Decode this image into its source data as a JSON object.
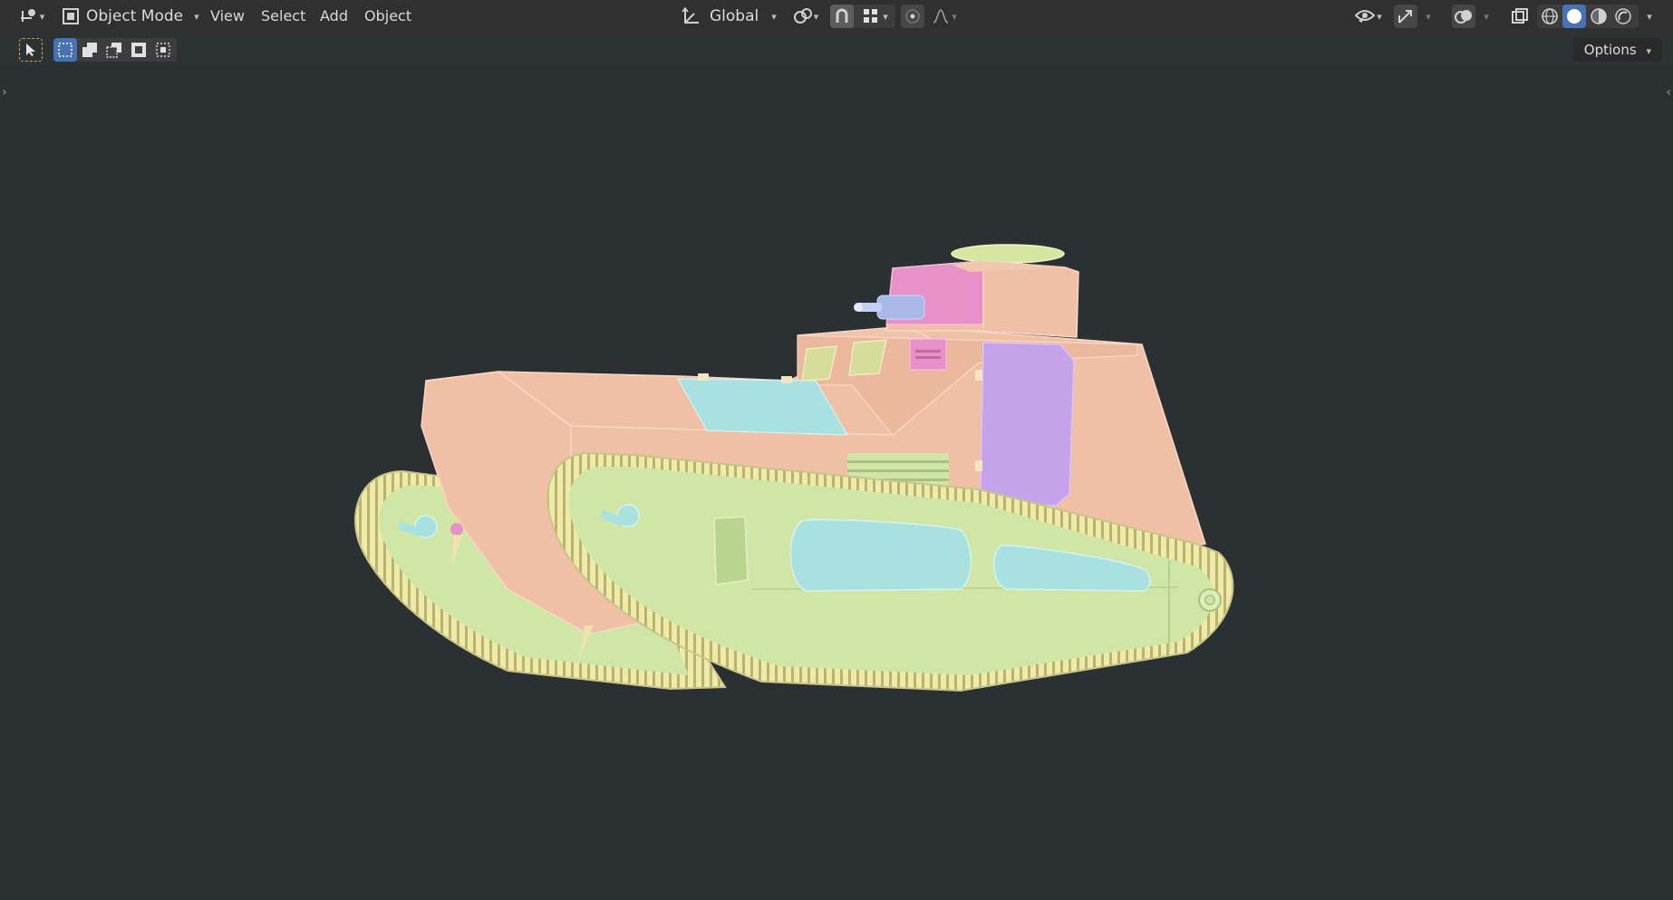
{
  "header": {
    "mode_label": "Object Mode",
    "menus": [
      "View",
      "Select",
      "Add",
      "Object"
    ],
    "transform_orientation": "Global"
  },
  "toolbar": {
    "options_label": "Options"
  },
  "viewport": {
    "background": "#2b3133",
    "model_colors": {
      "hull": "#efc0a6",
      "track": "#cfe6a6",
      "tread": "#eeeaa8",
      "glass": "#a9e0e0",
      "hatch": "#c5a2ea",
      "turret_panel": "#e890c8",
      "gun": "#a8b8e8"
    }
  },
  "icons": [
    "editor-type-icon",
    "object-mode-icon",
    "orientation-gizmo-icon",
    "pivot-icon",
    "snap-icon",
    "snap-increment-icon",
    "proportional-edit-icon",
    "falloff-icon",
    "visibility-icon",
    "gizmo-icon",
    "overlay-icon",
    "xray-icon",
    "wireframe-shading-icon",
    "solid-shading-icon",
    "material-shading-icon",
    "rendered-shading-icon",
    "select-cursor-icon",
    "select-box-new-icon",
    "select-extend-icon",
    "select-subtract-icon",
    "select-invert-icon",
    "select-intersect-icon"
  ]
}
